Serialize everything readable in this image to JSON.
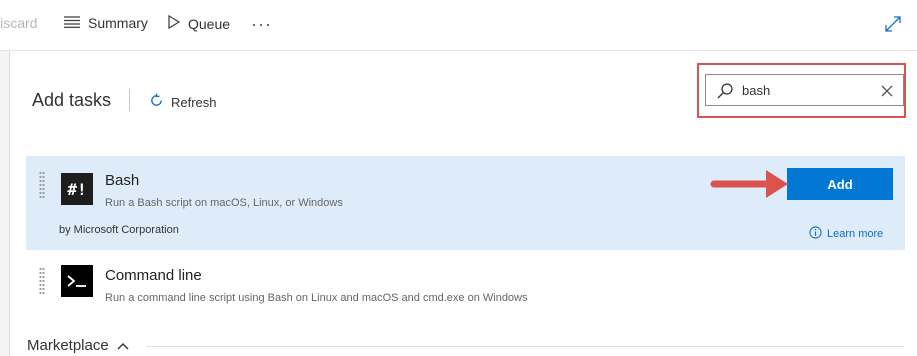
{
  "toolbar": {
    "discard_label": "Discard",
    "summary_label": "Summary",
    "queue_label": "Queue",
    "more_label": "···"
  },
  "panel": {
    "title": "Add tasks",
    "refresh_label": "Refresh"
  },
  "search": {
    "value": "bash",
    "placeholder": ""
  },
  "tasks": [
    {
      "name": "Bash",
      "icon": "#!",
      "description": "Run a Bash script on macOS, Linux, or Windows",
      "author": "by Microsoft Corporation",
      "add_label": "Add",
      "learn_more_label": "Learn more",
      "selected": true
    },
    {
      "name": "Command line",
      "icon": "terminal-icon",
      "description": "Run a command line script using Bash on Linux and macOS and cmd.exe on Windows"
    }
  ],
  "marketplace": {
    "label": "Marketplace"
  },
  "colors": {
    "accent": "#0078d4",
    "selected_row": "#deecf9",
    "highlight": "#d9534f"
  }
}
